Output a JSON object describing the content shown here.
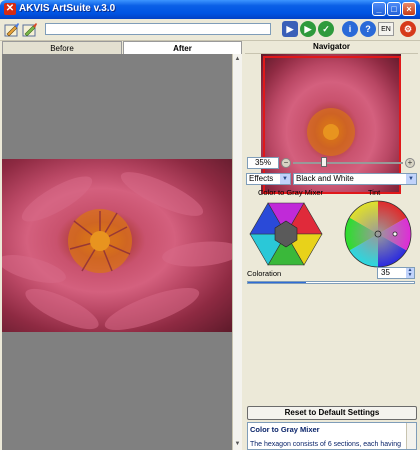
{
  "window": {
    "title": "AKVIS ArtSuite v.3.0",
    "app_icon_glyph": "✕",
    "controls": {
      "minimize": "_",
      "maximize": "□",
      "close": "×"
    }
  },
  "toolbar": {
    "icons": [
      "open-image-icon",
      "save-image-icon"
    ],
    "buttons": [
      {
        "name": "run-button",
        "glyph": "▶",
        "color": "#3a5fb8"
      },
      {
        "name": "play-button",
        "glyph": "▶",
        "color": "#2e9a3c"
      },
      {
        "name": "apply-button",
        "glyph": "✓",
        "color": "#2e9a3c"
      },
      {
        "name": "info-button",
        "glyph": "i",
        "color": "#2a6ad8"
      },
      {
        "name": "help-button",
        "glyph": "?",
        "color": "#2a6ad8"
      },
      {
        "name": "preferences-button",
        "glyph": "⚙",
        "color": "#d63a1a"
      }
    ],
    "language": "EN"
  },
  "tabs": {
    "before": "Before",
    "after": "After"
  },
  "navigator": {
    "title": "Navigator",
    "zoom_value": "35%",
    "zoom_minus": "−",
    "zoom_plus": "+",
    "zoom_level_fraction": 0.35
  },
  "settings": {
    "effects_label": "Effects",
    "preset": "Black and White",
    "color_to_gray_mixer_label": "Color to Gray Mixer",
    "tint_label": "Tint",
    "coloration_label": "Coloration",
    "coloration_value": "35",
    "coloration_fraction": 0.35,
    "reset_button": "Reset to Default Settings"
  },
  "help": {
    "title": "Color to Gray Mixer",
    "body": "The hexagon consists of 6 sections, each having"
  },
  "colors": {
    "titlebar": "#0054e3",
    "panel_bg": "#ece9d8",
    "canvas_bg": "#808080",
    "nav_frame": "#e0181a",
    "help_text": "#0a246a"
  }
}
